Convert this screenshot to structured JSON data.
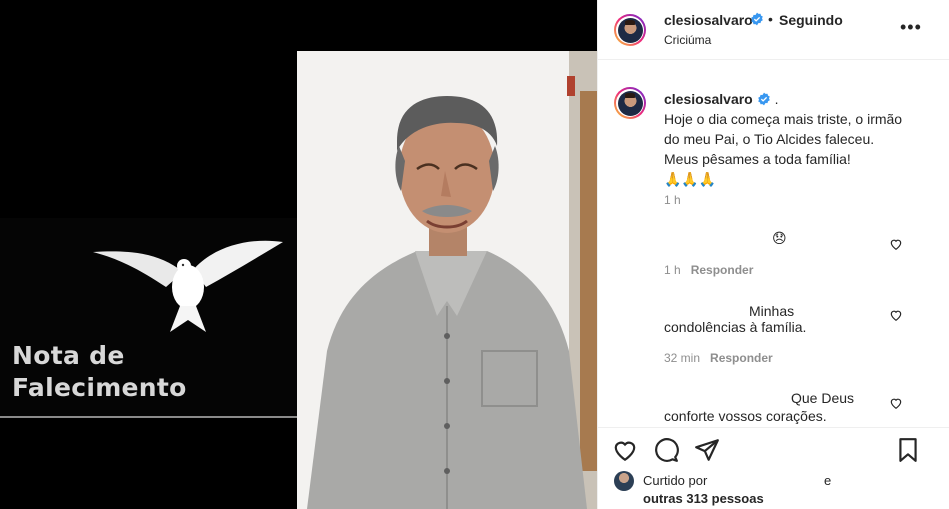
{
  "media": {
    "nota_title": "Nota de\nFalecimento"
  },
  "header": {
    "username": "clesiosalvaro",
    "separator": "•",
    "follow_state": "Seguindo",
    "location": "Criciúma",
    "more_icon": "more-options-icon"
  },
  "caption": {
    "username": "clesiosalvaro",
    "username_suffix": " .",
    "lines": [
      "Hoje o dia começa mais triste, o irmão",
      "do meu Pai, o Tio Alcides faleceu.",
      "Meus pêsames a toda família!",
      "🙏🙏🙏"
    ],
    "time": "1 h"
  },
  "comments": [
    {
      "text": "😞",
      "time": "1 h",
      "reply": "Responder"
    },
    {
      "text_line1": "Minhas",
      "text_line2": "condolências à família.",
      "time": "32 min",
      "reply": "Responder"
    },
    {
      "text_line1": "Que Deus",
      "text_line2": "conforte vossos corações.",
      "time": "",
      "reply": ""
    }
  ],
  "likes": {
    "liked_by": "Curtido por",
    "trailing": "e",
    "others": "outras 313 pessoas"
  },
  "colors": {
    "verified": "#3897f0",
    "text": "#262626",
    "muted": "#8e8e8e",
    "border": "#efefef"
  }
}
